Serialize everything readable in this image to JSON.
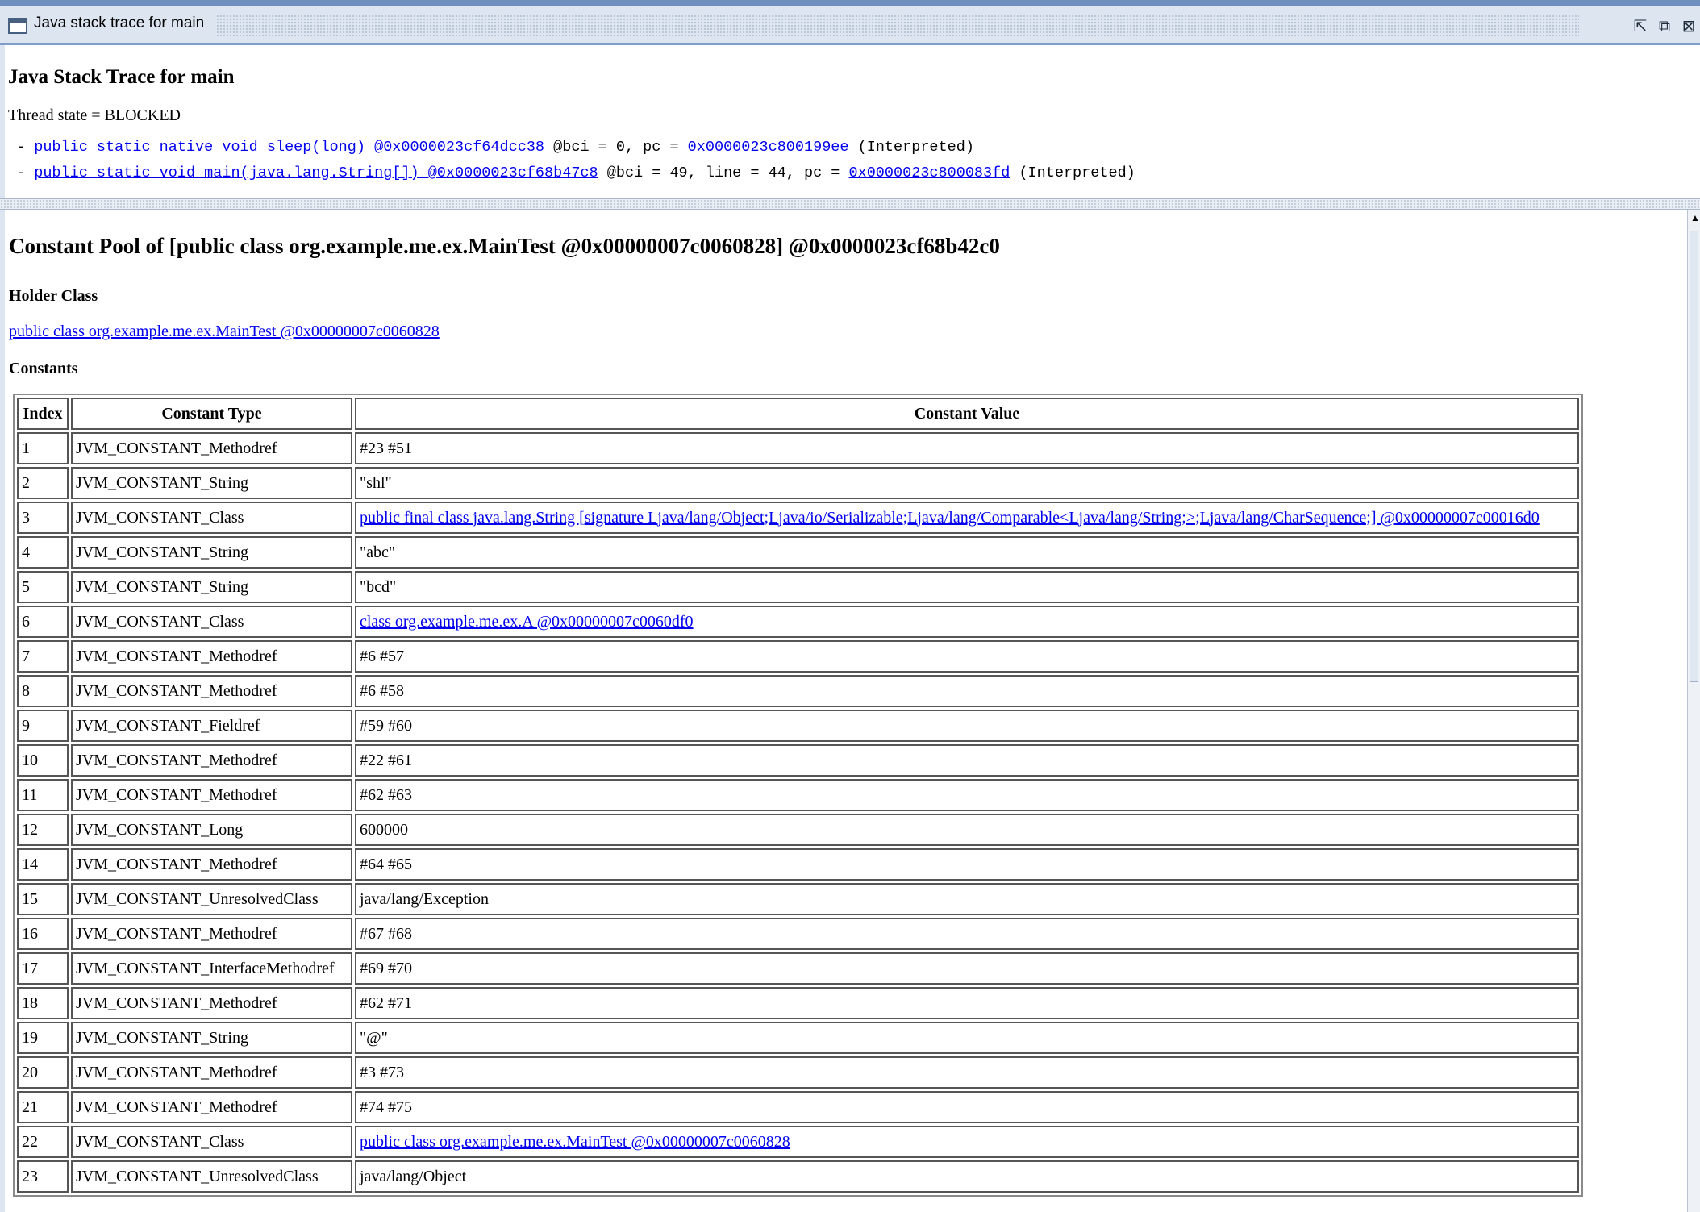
{
  "window": {
    "title": "Java stack trace for main"
  },
  "stack_trace": {
    "heading": "Java Stack Trace for main",
    "thread_state": "Thread state = BLOCKED",
    "frames": [
      {
        "prefix": "- ",
        "method_link": "public static native void sleep(long) @0x0000023cf64dcc38",
        "detail": " @bci = 0, pc = ",
        "pc_link": "0x0000023c800199ee",
        "suffix": " (Interpreted)"
      },
      {
        "prefix": "- ",
        "method_link": "public static void main(java.lang.String[]) @0x0000023cf68b47c8",
        "detail": " @bci = 49, line = 44, pc = ",
        "pc_link": "0x0000023c800083fd",
        "suffix": " (Interpreted)"
      }
    ]
  },
  "constant_pool": {
    "heading": "Constant Pool of [public class org.example.me.ex.MainTest @0x00000007c0060828] @0x0000023cf68b42c0",
    "holder_label": "Holder Class",
    "holder_link": "public class org.example.me.ex.MainTest @0x00000007c0060828",
    "constants_label": "Constants",
    "columns": [
      "Index",
      "Constant Type",
      "Constant Value"
    ],
    "rows": [
      {
        "index": "1",
        "type": "JVM_CONSTANT_Methodref",
        "value": "#23 #51",
        "link": false
      },
      {
        "index": "2",
        "type": "JVM_CONSTANT_String",
        "value": "\"shl\"",
        "link": false
      },
      {
        "index": "3",
        "type": "JVM_CONSTANT_Class",
        "value": "public final class java.lang.String [signature Ljava/lang/Object;Ljava/io/Serializable;Ljava/lang/Comparable<Ljava/lang/String;>;Ljava/lang/CharSequence;] @0x00000007c00016d0",
        "link": true
      },
      {
        "index": "4",
        "type": "JVM_CONSTANT_String",
        "value": "\"abc\"",
        "link": false
      },
      {
        "index": "5",
        "type": "JVM_CONSTANT_String",
        "value": "\"bcd\"",
        "link": false
      },
      {
        "index": "6",
        "type": "JVM_CONSTANT_Class",
        "value": "class org.example.me.ex.A @0x00000007c0060df0",
        "link": true
      },
      {
        "index": "7",
        "type": "JVM_CONSTANT_Methodref",
        "value": "#6 #57",
        "link": false
      },
      {
        "index": "8",
        "type": "JVM_CONSTANT_Methodref",
        "value": "#6 #58",
        "link": false
      },
      {
        "index": "9",
        "type": "JVM_CONSTANT_Fieldref",
        "value": "#59 #60",
        "link": false
      },
      {
        "index": "10",
        "type": "JVM_CONSTANT_Methodref",
        "value": "#22 #61",
        "link": false
      },
      {
        "index": "11",
        "type": "JVM_CONSTANT_Methodref",
        "value": "#62 #63",
        "link": false
      },
      {
        "index": "12",
        "type": "JVM_CONSTANT_Long",
        "value": "600000",
        "link": false
      },
      {
        "index": "14",
        "type": "JVM_CONSTANT_Methodref",
        "value": "#64 #65",
        "link": false
      },
      {
        "index": "15",
        "type": "JVM_CONSTANT_UnresolvedClass",
        "value": "java/lang/Exception",
        "link": false
      },
      {
        "index": "16",
        "type": "JVM_CONSTANT_Methodref",
        "value": "#67 #68",
        "link": false
      },
      {
        "index": "17",
        "type": "JVM_CONSTANT_InterfaceMethodref",
        "value": "#69 #70",
        "link": false
      },
      {
        "index": "18",
        "type": "JVM_CONSTANT_Methodref",
        "value": "#62 #71",
        "link": false
      },
      {
        "index": "19",
        "type": "JVM_CONSTANT_String",
        "value": "\"@\"",
        "link": false
      },
      {
        "index": "20",
        "type": "JVM_CONSTANT_Methodref",
        "value": "#3 #73",
        "link": false
      },
      {
        "index": "21",
        "type": "JVM_CONSTANT_Methodref",
        "value": "#74 #75",
        "link": false
      },
      {
        "index": "22",
        "type": "JVM_CONSTANT_Class",
        "value": "public class org.example.me.ex.MainTest @0x00000007c0060828",
        "link": true
      },
      {
        "index": "23",
        "type": "JVM_CONSTANT_UnresolvedClass",
        "value": "java/lang/Object",
        "link": false
      }
    ]
  },
  "icons": {
    "window": "window-icon",
    "minimize": "minimize-icon",
    "restore": "restore-icon",
    "close": "close-icon",
    "scroll_up": "scroll-up-arrow-icon"
  },
  "colors": {
    "link": "#0000ee",
    "titlebar": "#dde6f0",
    "titlebar_border": "#6e8fbf"
  }
}
